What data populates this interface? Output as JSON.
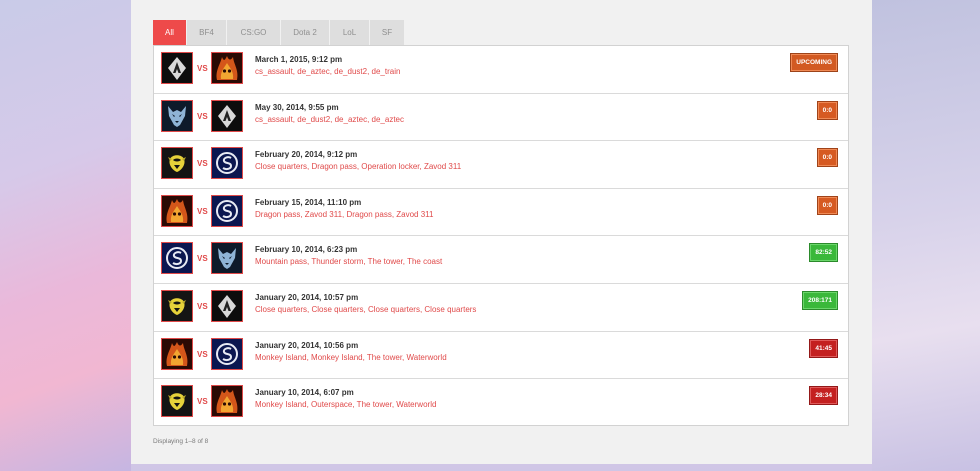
{
  "tabs": [
    {
      "label": "All",
      "active": true
    },
    {
      "label": "BF4",
      "active": false
    },
    {
      "label": "CS:GO",
      "active": false
    },
    {
      "label": "Dota 2",
      "active": false
    },
    {
      "label": "LoL",
      "active": false
    },
    {
      "label": "SF",
      "active": false
    }
  ],
  "vs_label": "VS",
  "matches": [
    {
      "team1": "alliance-logo-icon",
      "team2": "flame-skull-logo-icon",
      "date": "March 1, 2015, 9:12 pm",
      "maps": "cs_assault, de_aztec, de_dust2, de_train",
      "result": "UPCOMING",
      "status": "upcoming"
    },
    {
      "team1": "wolf-logo-icon",
      "team2": "alliance-logo-icon",
      "date": "May 30, 2014, 9:55 pm",
      "maps": "cs_assault, de_dust2, de_aztec, de_aztec",
      "result": "0:0",
      "status": "draw"
    },
    {
      "team1": "yellow-crest-logo-icon",
      "team2": "sk-logo-icon",
      "date": "February 20, 2014, 9:12 pm",
      "maps": "Close quarters, Dragon pass, Operation locker, Zavod 311",
      "result": "0:0",
      "status": "draw"
    },
    {
      "team1": "flame-skull-logo-icon",
      "team2": "sk-logo-icon",
      "date": "February 15, 2014, 11:10 pm",
      "maps": "Dragon pass, Zavod 311, Dragon pass, Zavod 311",
      "result": "0:0",
      "status": "draw"
    },
    {
      "team1": "sk-logo-icon",
      "team2": "wolf-logo-icon",
      "date": "February 10, 2014, 6:23 pm",
      "maps": "Mountain pass, Thunder storm, The tower, The coast",
      "result": "82:52",
      "status": "win"
    },
    {
      "team1": "yellow-crest-logo-icon",
      "team2": "alliance-logo-icon",
      "date": "January 20, 2014, 10:57 pm",
      "maps": "Close quarters, Close quarters, Close quarters, Close quarters",
      "result": "208:171",
      "status": "win"
    },
    {
      "team1": "flame-skull-logo-icon",
      "team2": "sk-logo-icon",
      "date": "January 20, 2014, 10:56 pm",
      "maps": "Monkey Island, Monkey Island, The tower, Waterworld",
      "result": "41:45",
      "status": "loss"
    },
    {
      "team1": "yellow-crest-logo-icon",
      "team2": "flame-skull-logo-icon",
      "date": "January 10, 2014, 6:07 pm",
      "maps": "Monkey Island, Outerspace, The tower, Waterworld",
      "result": "28:34",
      "status": "loss"
    }
  ],
  "footer": {
    "text": "Displaying 1–8 of 8"
  },
  "colors": {
    "accent": "#ee4a4a",
    "upcoming": "#d25a22",
    "win": "#3ab83a",
    "loss": "#c42020"
  }
}
